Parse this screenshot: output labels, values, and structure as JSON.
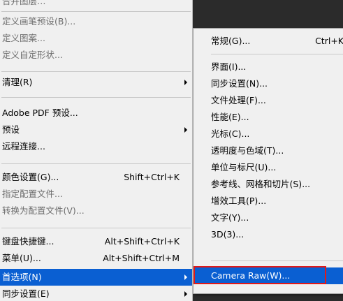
{
  "main_menu": {
    "items": [
      {
        "label": "合并图层…",
        "disabled": true
      },
      {
        "label": "定义画笔预设(B)...",
        "disabled": true
      },
      {
        "label": "定义图案...",
        "disabled": true
      },
      {
        "label": "定义自定形状...",
        "disabled": true
      },
      {
        "label": "清理(R)"
      },
      {
        "label": "Adobe PDF 预设..."
      },
      {
        "label": "预设"
      },
      {
        "label": "远程连接..."
      },
      {
        "label": "颜色设置(G)...",
        "shortcut": "Shift+Ctrl+K"
      },
      {
        "label": "指定配置文件...",
        "disabled": true
      },
      {
        "label": "转换为配置文件(V)...",
        "disabled": true
      },
      {
        "label": "键盘快捷键...",
        "shortcut": "Alt+Shift+Ctrl+K"
      },
      {
        "label": "菜单(U)...",
        "shortcut": "Alt+Shift+Ctrl+M"
      },
      {
        "label": "首选项(N)",
        "selected": true
      },
      {
        "label": "同步设置(E)"
      }
    ]
  },
  "sub_menu": {
    "items": [
      {
        "label": "常规(G)...",
        "shortcut": "Ctrl+K"
      },
      {
        "label": "界面(I)..."
      },
      {
        "label": "同步设置(N)..."
      },
      {
        "label": "文件处理(F)..."
      },
      {
        "label": "性能(E)..."
      },
      {
        "label": "光标(C)..."
      },
      {
        "label": "透明度与色域(T)..."
      },
      {
        "label": "单位与标尺(U)..."
      },
      {
        "label": "参考线、网格和切片(S)..."
      },
      {
        "label": "增效工具(P)..."
      },
      {
        "label": "文字(Y)..."
      },
      {
        "label": "3D(3)..."
      },
      {
        "label": "Camera Raw(W)...",
        "highlighted": true
      }
    ]
  },
  "colors": {
    "selection": "#0a5fd2",
    "menu_bg": "#f0f0f0",
    "highlight_border": "#e01919"
  },
  "icons": [
    "submenu-arrow-icon"
  ]
}
